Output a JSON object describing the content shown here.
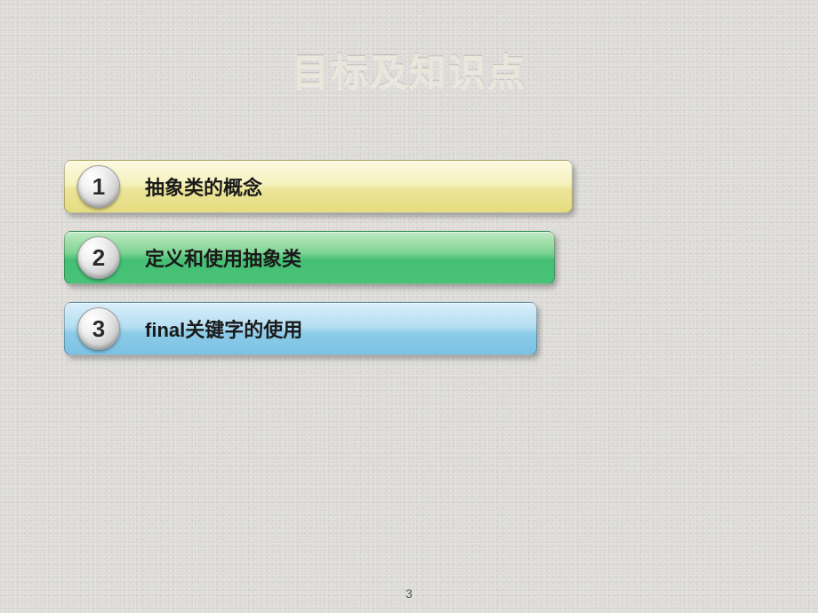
{
  "title": "目标及知识点",
  "items": [
    {
      "num": "1",
      "label": "抽象类的概念"
    },
    {
      "num": "2",
      "label": "定义和使用抽象类"
    },
    {
      "num": "3",
      "label": "final关键字的使用"
    }
  ],
  "page_number": "3"
}
